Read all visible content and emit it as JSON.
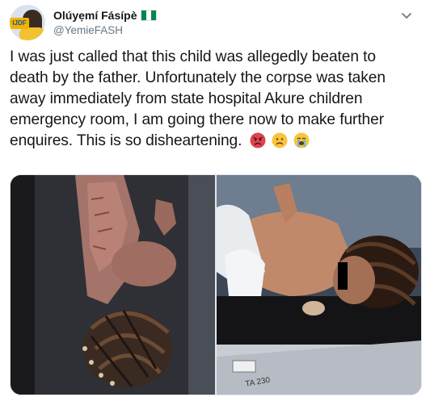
{
  "tweet": {
    "author": {
      "display_name": "Olúyẹmí Fásípè",
      "handle": "@YemieFASH",
      "avatar_badge_text": "IJDF",
      "verified_flag": "nigeria-flag"
    },
    "text": "I was just called that this child was allegedly beaten to death by the father. Unfortunately the corpse was taken away immediately from state hospital Akure children emergency room, I am going there now to make further enquires. This is so disheartening.",
    "emojis": [
      "angry-face",
      "frowning-face",
      "loudly-crying-face"
    ],
    "media": [
      {
        "name": "photo-left",
        "description_icon": "photo"
      },
      {
        "name": "photo-right",
        "description_icon": "photo",
        "label_text": "TA 230"
      }
    ]
  },
  "colors": {
    "text_primary": "#14171a",
    "text_secondary": "#657786",
    "flag_green": "#008751",
    "flag_white": "#ffffff",
    "border": "#e1e8ed"
  }
}
